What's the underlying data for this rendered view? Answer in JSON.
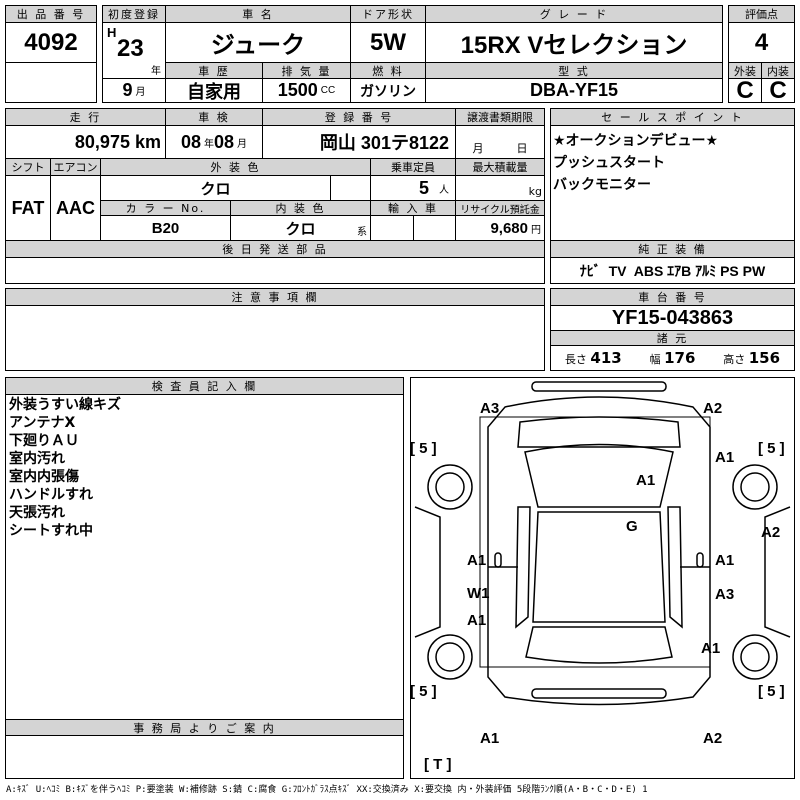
{
  "lot": {
    "label": "出 品 番 号",
    "value": "4092"
  },
  "first_reg": {
    "label": "初度登録",
    "era": "H",
    "year": "23",
    "year_unit": "年",
    "month": "9",
    "month_unit": "月"
  },
  "car_name": {
    "label": "車 名",
    "value": "ジューク"
  },
  "door": {
    "label": "ドア形状",
    "value": "5W"
  },
  "grade": {
    "label": "グ レ ー ド",
    "value": "15RX Vセレクション"
  },
  "score": {
    "label": "評価点",
    "value": "4",
    "ext_label": "外装",
    "int_label": "内装",
    "ext": "C",
    "int": "C"
  },
  "history": {
    "label": "車 歴",
    "value": "自家用"
  },
  "displacement": {
    "label": "排 気 量",
    "value": "1500",
    "unit": "CC"
  },
  "fuel": {
    "label": "燃 料",
    "value": "ガソリン"
  },
  "model": {
    "label": "型 式",
    "value": "DBA-YF15"
  },
  "mileage": {
    "label": "走 行",
    "value": "80,975",
    "unit": "km"
  },
  "inspection": {
    "label": "車 検",
    "year": "08",
    "year_unit": "年",
    "month": "08",
    "month_unit": "月"
  },
  "registration": {
    "label": "登 録 番 号",
    "value": "岡山 301テ8122"
  },
  "transfer": {
    "label": "譲渡書類期限",
    "month_unit": "月",
    "day_unit": "日"
  },
  "shift": {
    "label": "シフト",
    "value": "FAT"
  },
  "aircon": {
    "label": "エアコン",
    "value": "AAC"
  },
  "ext_color": {
    "label": "外 装 色",
    "value": "クロ"
  },
  "capacity": {
    "label": "乗車定員",
    "value": "5",
    "unit": "人"
  },
  "max_load": {
    "label": "最大積載量",
    "unit": "kg"
  },
  "color_no": {
    "label": "カ ラ ー No.",
    "value": "B20"
  },
  "int_color": {
    "label": "内 装 色",
    "value": "クロ",
    "unit": "系"
  },
  "import": {
    "label": "輸 入 車"
  },
  "recycle": {
    "label": "リサイクル預託金",
    "value": "9,680",
    "unit": "円"
  },
  "later_parts": {
    "label": "後 日 発 送 部 品"
  },
  "sales_points": {
    "label": "セ ー ル ス ポ イ ン ト",
    "items": [
      "★オークションデビュー★",
      "プッシュスタート",
      "バックモニター"
    ]
  },
  "equipment": {
    "label": "純 正 装 備",
    "value": "ﾅﾋﾞ  TV  ABS ｴｱB ｱﾙﾐ PS PW"
  },
  "notes": {
    "label": "注 意 事 項 欄"
  },
  "chassis": {
    "label": "車 台 番 号",
    "value": "YF15-043863",
    "spec_label": "諸 元",
    "length_label": "長さ",
    "length": "413",
    "width_label": "幅",
    "width": "176",
    "height_label": "高さ",
    "height": "156"
  },
  "inspector": {
    "label": "検 査 員 記 入 欄",
    "items": [
      "外装うすい線キズ",
      "アンテナX",
      "下廻りＡＵ",
      "室内汚れ",
      "室内内張傷",
      "ハンドルすれ",
      "天張汚れ",
      "シートすれ中"
    ]
  },
  "office": {
    "label": "事 務 局 よ り ご 案 内"
  },
  "diagram": {
    "marks": [
      "A3",
      "A2",
      "A1",
      "A1",
      "G",
      "A2",
      "A1",
      "A1",
      "W1",
      "A3",
      "A1",
      "A1",
      "A1",
      "A2"
    ],
    "tires": [
      "[ 5 ]",
      "[ 5 ]",
      "[ 5 ]",
      "[ 5 ]",
      "[ T ]"
    ]
  },
  "legend": "A:ｷｽﾞ U:ﾍｺﾐ B:ｷｽﾞを伴うﾍｺﾐ P:要塗装 W:補修跡 S:錆 C:腐食 G:ﾌﾛﾝﾄｶﾞﾗｽ点ｷｽﾞ XX:交換済み X:要交換  内・外装評価  5段階ﾗﾝｸ順(A・B・C・D・E) 1"
}
